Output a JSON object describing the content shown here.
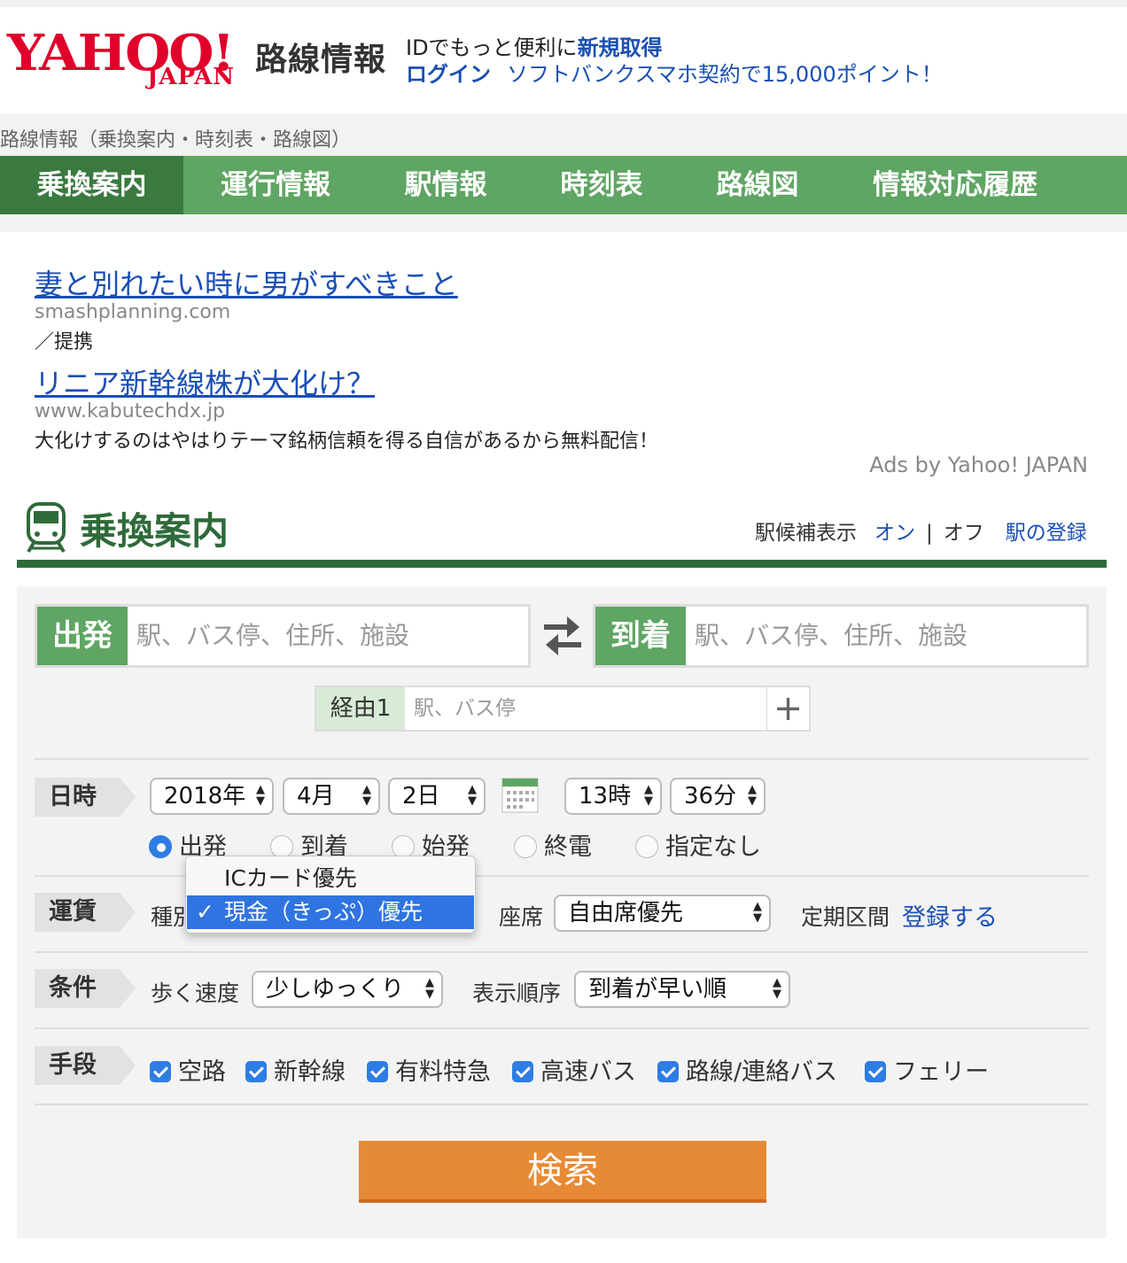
{
  "header": {
    "logo_main": "YAHOO!",
    "logo_sub": "JAPAN",
    "service_name": "路線情報",
    "promo_text": "IDでもっと便利に",
    "promo_link": "新規取得",
    "login_link": "ログイン",
    "softbank_text": "ソフトバンクスマホ契約で15,000ポイント！"
  },
  "breadcrumb": "路線情報（乗換案内・時刻表・路線図）",
  "nav": {
    "tabs": [
      {
        "label": "乗換案内",
        "active": true
      },
      {
        "label": "運行情報"
      },
      {
        "label": "駅情報"
      },
      {
        "label": "時刻表"
      },
      {
        "label": "路線図"
      },
      {
        "label": "情報対応履歴"
      }
    ]
  },
  "ads": [
    {
      "title": "妻と別れたい時に男がすべきこと",
      "url": "smashplanning.com",
      "desc": "／提携"
    },
    {
      "title": "リニア新幹線株が大化け？",
      "url": "www.kabutechdx.jp",
      "desc": "大化けするのはやはりテーマ銘柄信頼を得る自信があるから無料配信！"
    }
  ],
  "ads_by": "Ads by Yahoo! JAPAN",
  "section": {
    "title": "乗換案内",
    "suggest_label": "駅候補表示",
    "suggest_on": "オン",
    "suggest_sep": "|",
    "suggest_off": "オフ",
    "station_register": "駅の登録"
  },
  "form": {
    "origin_label": "出発",
    "origin_placeholder": "駅、バス停、住所、施設",
    "dest_label": "到着",
    "dest_placeholder": "駅、バス停、住所、施設",
    "via_label": "経由1",
    "via_placeholder": "駅、バス停",
    "via_add": "+",
    "datetime_label": "日時",
    "year": "2018年",
    "month": "4月",
    "day": "2日",
    "hour": "13時",
    "minute": "36分",
    "time_modes": [
      "出発",
      "到着",
      "始発",
      "終電",
      "指定なし"
    ],
    "time_mode_selected": 0,
    "fare_label": "運賃",
    "fare_kind_label": "種別",
    "fare_options": [
      "ICカード優先",
      "現金（きっぷ）優先"
    ],
    "fare_selected": 1,
    "seat_label": "座席",
    "seat_value": "自由席優先",
    "commuter_label": "定期区間",
    "commuter_link": "登録する",
    "cond_label": "条件",
    "walk_label": "歩く速度",
    "walk_value": "少しゆっくり",
    "order_label": "表示順序",
    "order_value": "到着が早い順",
    "means_label": "手段",
    "means": [
      "空路",
      "新幹線",
      "有料特急",
      "高速バス",
      "路線/連絡バス",
      "フェリー"
    ],
    "search_button": "検索"
  },
  "colors": {
    "accent_green": "#5fa563",
    "dark_green": "#2f6a3a",
    "link_blue": "#1a4fb4",
    "search_orange": "#e78a35",
    "yahoo_red": "#e0002b"
  }
}
